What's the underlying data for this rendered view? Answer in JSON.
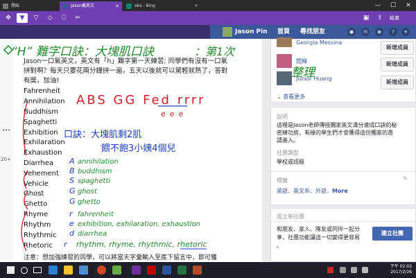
{
  "tabs": [
    {
      "label": "開始"
    },
    {
      "label": "Jason瘋英文"
    },
    {
      "label": "abs - Bing"
    }
  ],
  "window": {
    "minimize": "—",
    "maximize": "☐",
    "close": "✕"
  },
  "inkbar": {
    "end_label": "結束"
  },
  "facebook": {
    "user_name": "Jason Pin",
    "home": "首頁",
    "find_friends": "尋找朋友"
  },
  "post": {
    "intro_lines": [
      "Jason一口氣英文，英文有「h」難字第一天練習; 同學們有沒有一口氣",
      "拼對啊？每天只要花兩分鐘拼一遍，五天以後就可以駕輕就熟了，答對",
      "有獎，加油!"
    ],
    "words": [
      "Fahrenheit",
      "Annihilation",
      "Buddhism",
      "Spaghetti",
      "Exhibition",
      "Exhilaration",
      "Exhaustion",
      "Diarrhea",
      "Vehement",
      "Vehicle",
      "Ghost",
      "Ghetto",
      "Rhyme",
      "Rhythm",
      "Rhythmic",
      "Rhetoric"
    ],
    "footer": "注意：想加強練習的同學，可以將當天字彙輸入至底下留言中，即可獲"
  },
  "left_strip": {
    "more": "•••",
    "count": "20+"
  },
  "sidebar": {
    "members": [
      {
        "name": "Georgia Messina",
        "button": "新增成員"
      },
      {
        "name": "閻輝",
        "button": "新增成員"
      },
      {
        "name": "Junior Huang",
        "button": "新增成員"
      }
    ],
    "see_more": "查看更多",
    "about_title": "說明",
    "about_text": [
      "這裡是Jason老師傳授獨家英文滿分速成口訣的秘",
      "密練功房，有緣的學生們才會獲得這份獨家的邀",
      "請進入。"
    ],
    "type_title": "社團類型",
    "type_value": "學校或班級",
    "tags_title": "標籤",
    "tags_value": "英語．英文系．外語．",
    "tags_more": "More",
    "create_title": "成立新社團",
    "create_text": [
      "和朋友、家人、隊友或同伴一起分",
      "享，社團功能讓這一切變得更容易",
      "。"
    ],
    "create_button": "建立社團"
  },
  "annotations": {
    "title": "“H” 難字口訣：大塊肌口訣：大塊肌口訣（第1次整理）",
    "title_part1": "“H” 難字口訣：大塊肌口訣",
    "title_part2": "：第1次",
    "title_part3": "整理",
    "red_header": "ABS GG Fed rrrr",
    "red_sub": "eee",
    "blue_line1": "口訣：大塊肌剩2肌",
    "blue_line2": "餵不飽3小姨4個兒",
    "letters": [
      "A",
      "B",
      "S",
      "G",
      "G",
      "r",
      "e",
      "d",
      "r"
    ],
    "green_lines": [
      "annihilation",
      "buddhism",
      "spaghetti",
      "ghost",
      "ghetto",
      "fahrenheit",
      "exhibition, exhilaration, exhaustion",
      "diarrhea",
      "rhythm, rhyme, rhythmic, rhetoric"
    ]
  },
  "clock": {
    "time": "下午 02:03",
    "date": "2017/2/26"
  }
}
